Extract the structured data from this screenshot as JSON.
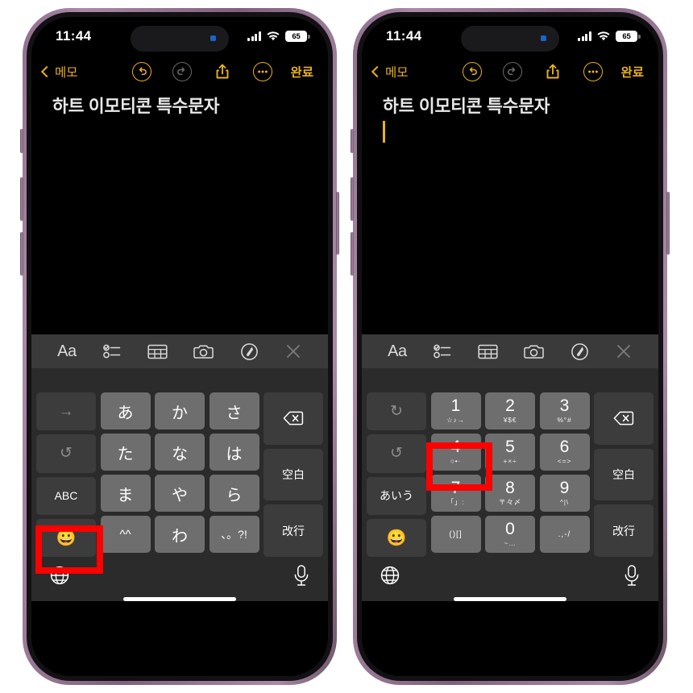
{
  "meta": {
    "accent_yellow": "#e8b11c",
    "highlight_red": "#fe0000",
    "key_bg": "#6e6e6e",
    "fn_key_bg": "#3c3c3c"
  },
  "status": {
    "time": "11:44",
    "battery": "65",
    "signal_icon": "cellular-bars-icon",
    "wifi_icon": "wifi-icon"
  },
  "nav": {
    "back_label": "메모",
    "undo_icon": "undo-icon",
    "redo_icon": "redo-icon",
    "share_icon": "share-icon",
    "more_icon": "more-ellipsis-icon",
    "done_label": "완료"
  },
  "note": {
    "title": "하트 이모티콘 특수문자"
  },
  "toolbar": {
    "items": [
      {
        "label": "Aa",
        "name": "format-text-icon"
      },
      {
        "label": "",
        "name": "checklist-icon"
      },
      {
        "label": "",
        "name": "table-icon"
      },
      {
        "label": "",
        "name": "camera-icon"
      },
      {
        "label": "",
        "name": "markup-pen-icon"
      },
      {
        "label": "",
        "name": "close-icon"
      }
    ]
  },
  "keyboard_left": {
    "mode": "kana-10key",
    "left_column": [
      {
        "label": "→",
        "name": "cursor-right-key",
        "dim": true
      },
      {
        "label": "↺",
        "name": "undo-key",
        "dim": true
      },
      {
        "label": "ABC",
        "name": "abc-mode-key",
        "dim": false
      },
      {
        "label": "😀",
        "name": "emoji-key",
        "dim": false
      }
    ],
    "grid": [
      [
        "あ",
        "か",
        "さ"
      ],
      [
        "た",
        "な",
        "は"
      ],
      [
        "ま",
        "や",
        "ら"
      ],
      [
        "^^",
        "わ",
        "、。?!"
      ]
    ],
    "right_column": [
      {
        "label": "⌫",
        "name": "delete-key"
      },
      {
        "label": "空白",
        "name": "space-key"
      },
      {
        "label": "改行",
        "name": "return-key"
      }
    ],
    "bottom": {
      "globe": "globe-icon",
      "mic": "microphone-icon"
    }
  },
  "keyboard_right": {
    "mode": "numeric-symbol-10key",
    "left_column": [
      {
        "label": "↻",
        "name": "redo-key",
        "dim": true
      },
      {
        "label": "↺",
        "name": "undo-key",
        "dim": true
      },
      {
        "label": "あいう",
        "name": "kana-mode-key",
        "dim": false
      },
      {
        "label": "😀",
        "name": "emoji-key",
        "dim": false
      }
    ],
    "grid": [
      [
        {
          "num": "1",
          "sub": "☆♪→"
        },
        {
          "num": "2",
          "sub": "¥$€"
        },
        {
          "num": "3",
          "sub": "%°#"
        }
      ],
      [
        {
          "num": "4",
          "sub": "○•·"
        },
        {
          "num": "5",
          "sub": "+×÷"
        },
        {
          "num": "6",
          "sub": "<=>"
        }
      ],
      [
        {
          "num": "7",
          "sub": "「」:"
        },
        {
          "num": "8",
          "sub": "〒々〆"
        },
        {
          "num": "9",
          "sub": "^|\\"
        }
      ],
      [
        {
          "num": "",
          "sub": "()[]"
        },
        {
          "num": "0",
          "sub": "~…"
        },
        {
          "num": "",
          "sub": ".,-/"
        }
      ]
    ],
    "right_column": [
      {
        "label": "⌫",
        "name": "delete-key"
      },
      {
        "label": "空白",
        "name": "space-key"
      },
      {
        "label": "改行",
        "name": "return-key"
      }
    ],
    "bottom": {
      "globe": "globe-icon",
      "mic": "microphone-icon"
    }
  },
  "annotations": [
    {
      "name": "highlight-abc-key",
      "target": "ABC"
    },
    {
      "name": "highlight-one-key",
      "target": "1"
    }
  ]
}
